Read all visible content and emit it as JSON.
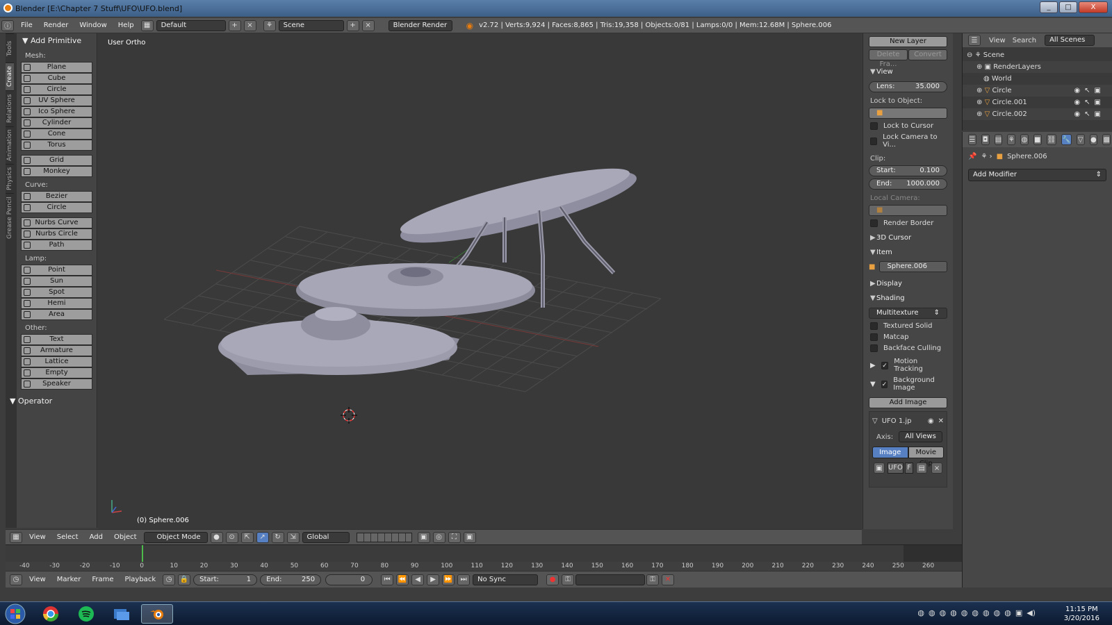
{
  "window": {
    "title": "Blender [E:\\Chapter 7 Stuff\\UFO\\UFO.blend]",
    "min": "_",
    "max": "□",
    "close": "X"
  },
  "menubar": {
    "items": [
      "File",
      "Render",
      "Window",
      "Help"
    ],
    "layout": "Default",
    "scene": "Scene",
    "engine": "Blender Render",
    "stats": "v2.72 | Verts:9,924 | Faces:8,865 | Tris:19,358 | Objects:0/81 | Lamps:0/0 | Mem:12.68M | Sphere.006"
  },
  "tabs": [
    "Tools",
    "Create",
    "Relations",
    "Animation",
    "Physics",
    "Grease Pencil"
  ],
  "toolshelf": {
    "title": "Add Primitive",
    "mesh_label": "Mesh:",
    "mesh": [
      "Plane",
      "Cube",
      "Circle",
      "UV Sphere",
      "Ico Sphere",
      "Cylinder",
      "Cone",
      "Torus"
    ],
    "mesh2": [
      "Grid",
      "Monkey"
    ],
    "curve_label": "Curve:",
    "curve": [
      "Bezier",
      "Circle"
    ],
    "curve2": [
      "Nurbs Curve",
      "Nurbs Circle",
      "Path"
    ],
    "lamp_label": "Lamp:",
    "lamp": [
      "Point",
      "Sun",
      "Spot",
      "Hemi",
      "Area"
    ],
    "other_label": "Other:",
    "other": [
      "Text",
      "Armature",
      "Lattice",
      "Empty",
      "Speaker"
    ],
    "operator": "Operator"
  },
  "viewport": {
    "label": "User Ortho",
    "object": "(0) Sphere.006"
  },
  "nprops": {
    "new_layer": "New Layer",
    "delete_frame": "Delete Fra...",
    "convert": "Convert",
    "view": "View",
    "lens_label": "Lens:",
    "lens_value": "35.000",
    "lock_to_object": "Lock to Object:",
    "lock_to_cursor": "Lock to Cursor",
    "lock_camera": "Lock Camera to Vi...",
    "clip": "Clip:",
    "start_label": "Start:",
    "start_value": "0.100",
    "end_label": "End:",
    "end_value": "1000.000",
    "local_camera": "Local Camera:",
    "render_border": "Render Border",
    "cursor": "3D Cursor",
    "item": "Item",
    "item_name": "Sphere.006",
    "display": "Display",
    "shading": "Shading",
    "shading_mode": "Multitexture",
    "textured_solid": "Textured Solid",
    "matcap": "Matcap",
    "backface": "Backface Culling",
    "motion_tracking": "Motion Tracking",
    "background_images": "Background Image",
    "add_image": "Add Image",
    "bg_name": "UFO 1.jp",
    "axis_label": "Axis:",
    "axis_value": "All Views",
    "image": "Image",
    "movie_clip": "Movie Clip",
    "ufo": "UFO",
    "f": "F"
  },
  "outliner": {
    "view": "View",
    "search": "Search",
    "all_scenes": "All Scenes",
    "rows": [
      "Scene",
      "RenderLayers",
      "World",
      "Circle",
      "Circle.001",
      "Circle.002"
    ]
  },
  "props": {
    "object": "Sphere.006",
    "add_modifier": "Add Modifier"
  },
  "vp_toolbar": {
    "view": "View",
    "select": "Select",
    "add": "Add",
    "object": "Object",
    "mode": "Object Mode",
    "orientation": "Global"
  },
  "timeline": {
    "ticks": [
      "-40",
      "-30",
      "-20",
      "-10",
      "0",
      "10",
      "20",
      "30",
      "40",
      "50",
      "60",
      "70",
      "80",
      "90",
      "100",
      "110",
      "120",
      "130",
      "140",
      "150",
      "160",
      "170",
      "180",
      "190",
      "200",
      "210",
      "220",
      "230",
      "240",
      "250",
      "260"
    ],
    "current_frame": 0
  },
  "tl_toolbar": {
    "view": "View",
    "marker": "Marker",
    "frame": "Frame",
    "playback": "Playback",
    "start_label": "Start:",
    "start_value": "1",
    "end_label": "End:",
    "end_value": "250",
    "current": "0",
    "sync": "No Sync"
  },
  "taskbar": {
    "time": "11:15 PM",
    "date": "3/20/2016"
  },
  "colors": {
    "accent": "#5680c2",
    "panel": "#464646",
    "button": "#9a9a9a",
    "orange": "#e87d0d"
  }
}
